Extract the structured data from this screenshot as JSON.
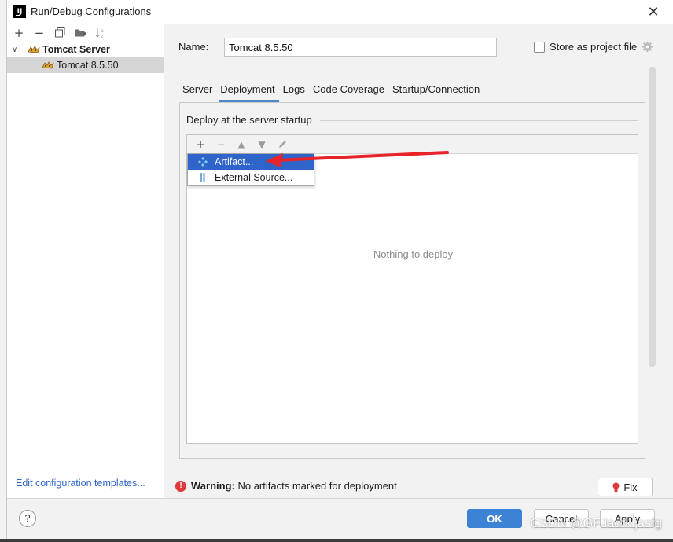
{
  "window": {
    "title": "Run/Debug Configurations"
  },
  "tree": {
    "root_label": "Tomcat Server",
    "child_label": "Tomcat 8.5.50"
  },
  "left_footer": {
    "edit_templates": "Edit configuration templates..."
  },
  "form": {
    "name_label": "Name:",
    "name_value": "Tomcat 8.5.50",
    "store_label": "Store as project file"
  },
  "tabs": [
    "Server",
    "Deployment",
    "Logs",
    "Code Coverage",
    "Startup/Connection"
  ],
  "active_tab": "Deployment",
  "deployment": {
    "group_title": "Deploy at the server startup",
    "empty_text": "Nothing to deploy",
    "popup_items": [
      "Artifact...",
      "External Source..."
    ]
  },
  "warning": {
    "bold": "Warning:",
    "text": "No artifacts marked for deployment",
    "fix_label": "Fix"
  },
  "footer": {
    "help": "?",
    "ok": "OK",
    "cancel": "Cancel",
    "apply": "Apply"
  },
  "watermark": "CSDN @GFJadfkljasfg",
  "colors": {
    "accent": "#3c83d6",
    "selection": "#2f65ca",
    "link": "#2f65ca",
    "warning": "#db3b3b",
    "annotation_arrow": "#e8232a"
  }
}
